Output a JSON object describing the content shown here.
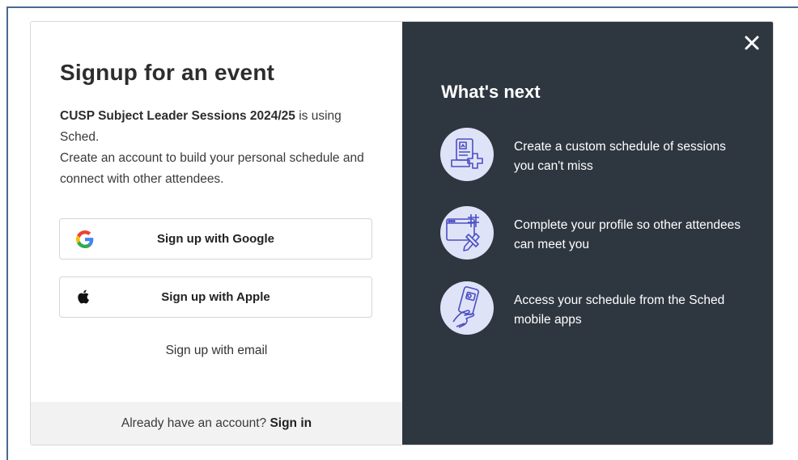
{
  "signup": {
    "title": "Signup for an event",
    "event_name": "CUSP Subject Leader Sessions 2024/25",
    "event_suffix": " is using Sched.",
    "description": "Create an account to build your personal schedule and connect with other attendees.",
    "google_button": "Sign up with Google",
    "apple_button": "Sign up with Apple",
    "email_link": "Sign up with email",
    "footer_prompt": "Already have an account? ",
    "signin_link": "Sign in"
  },
  "whats_next": {
    "title": "What's next",
    "features": [
      {
        "icon": "schedule-plus-icon",
        "text": "Create a custom schedule of sessions you can't miss"
      },
      {
        "icon": "profile-edit-icon",
        "text": "Complete your profile so other attendees can meet you"
      },
      {
        "icon": "mobile-app-icon",
        "text": "Access your schedule from the Sched mobile apps"
      }
    ]
  },
  "colors": {
    "right_panel_bg": "#2e3740",
    "icon_circle_bg": "#dfe3f7",
    "icon_stroke": "#4b4fc4",
    "footer_bg": "#f2f2f2"
  }
}
